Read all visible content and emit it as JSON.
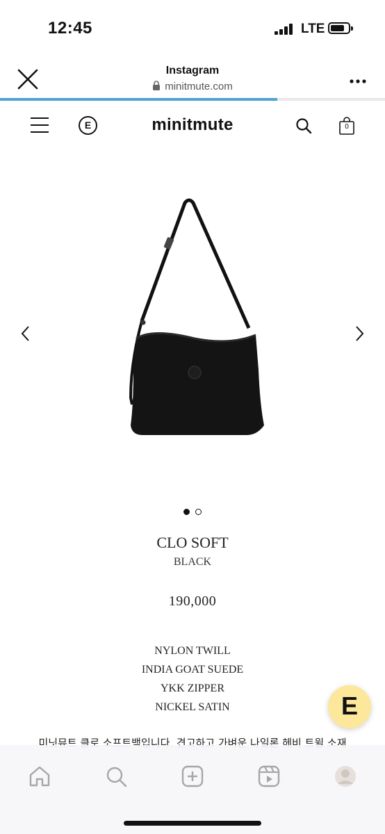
{
  "status_bar": {
    "time": "12:45",
    "network": "LTE",
    "signal_bars": 4,
    "battery_level": 0.8
  },
  "browser": {
    "title": "Instagram",
    "url": "minitmute.com",
    "load_progress": 0.72,
    "progress_color": "#4da3d6",
    "icons": [
      "close-icon",
      "lock-icon",
      "more-icon"
    ]
  },
  "site_nav": {
    "logo": "minitmute",
    "e_badge": "E",
    "cart_count": "0",
    "icons": [
      "hamburger-menu-icon",
      "e-circle-icon",
      "search-icon",
      "shopping-bag-icon"
    ]
  },
  "carousel": {
    "slide_count": 2,
    "active_slide": 1,
    "icons": [
      "chevron-left-icon",
      "chevron-right-icon"
    ]
  },
  "product": {
    "name": "CLO SOFT",
    "color": "BLACK",
    "price": "190,000",
    "materials": [
      "NYLON TWILL",
      "INDIA GOAT SUEDE",
      "YKK ZIPPER",
      "NICKEL SATIN"
    ],
    "description": "미닛뮤트 클로 소프트백입니다. 견고하고 가벼운 나일론 헤비 트윌 소재"
  },
  "floating_button": {
    "label": "E",
    "color": "#fce79a"
  },
  "tab_bar": {
    "icons": [
      "home-icon",
      "search-icon",
      "create-icon",
      "reels-icon",
      "profile-avatar-icon"
    ]
  }
}
